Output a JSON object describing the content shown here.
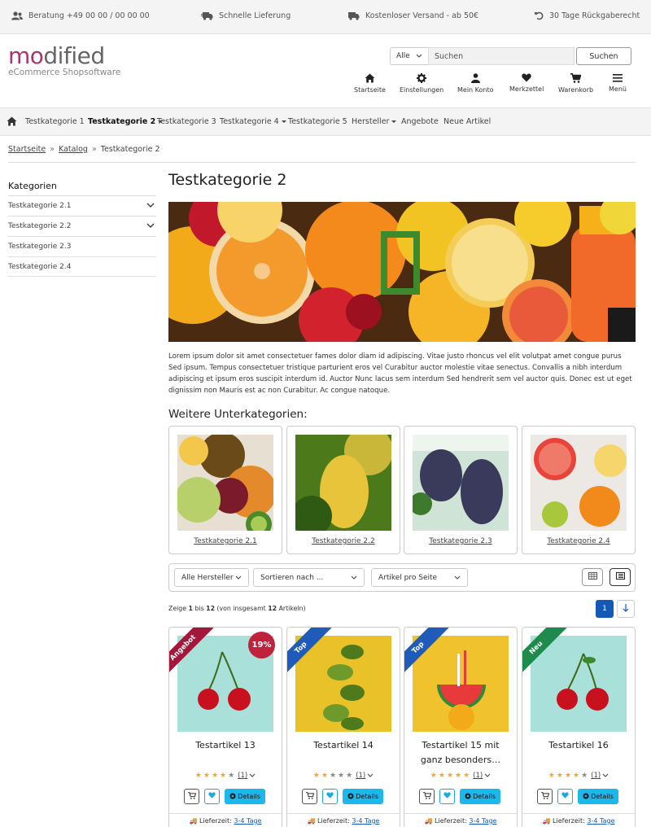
{
  "topbar": {
    "consult": "Beratung +49 00 00 / 00 00 00",
    "fast_delivery": "Schnelle Lieferung",
    "free_shipping": "Kostenloser Versand - ab 50€",
    "returns": "30 Tage Rückgaberecht"
  },
  "logo": {
    "main_accent": "mo",
    "main_rest": "dified",
    "sub": "eCommerce Shopsoftware"
  },
  "search": {
    "scope": "Alle",
    "placeholder": "Suchen",
    "button": "Suchen"
  },
  "header_icons": {
    "home": "Startseite",
    "settings": "Einstellungen",
    "account": "Mein Konto",
    "wishlist": "Merkzettel",
    "cart": "Warenkorb",
    "menu": "Menü"
  },
  "nav": {
    "items": [
      "Testkategorie 1",
      "Testkategorie 2",
      "Testkategorie 3",
      "Testkategorie 4",
      "Testkategorie 5",
      "Hersteller",
      "Angebote",
      "Neue Artikel"
    ]
  },
  "breadcrumb": {
    "home": "Startseite",
    "catalog": "Katalog",
    "current": "Testkategorie 2",
    "sep": "»"
  },
  "sidebar": {
    "title": "Kategorien",
    "items": [
      "Testkategorie 2.1",
      "Testkategorie 2.2",
      "Testkategorie 2.3",
      "Testkategorie 2.4"
    ]
  },
  "main": {
    "title": "Testkategorie 2",
    "description": "Lorem ipsum dolor sit amet consectetuer fames dolor diam id adipiscing. Vitae justo rhoncus vel elit volutpat amet congue purus Sed ipsum. Tempus consectetuer tristique parturient eros vel Curabitur auctor molestie vitae senectus. Convallis a nibh interdum adipiscing et ipsum eros suscipit interdum id. Auctor Nunc lacus sem interdum Sed hendrerit sem vel auctor quis. Donec est ut eget dignissim non Mauris est ac non Curabitur. Ac congue natoque.",
    "subcats_heading": "Weitere Unterkategorien:",
    "subcats": [
      "Testkategorie 2.1",
      "Testkategorie 2.2",
      "Testkategorie 2.3",
      "Testkategorie 2.4"
    ]
  },
  "filters": {
    "manufacturer": "Alle Hersteller",
    "sort": "Sortieren nach ...",
    "per_page": "Artikel pro Seite"
  },
  "paging": {
    "show": "Zeige",
    "from": "1",
    "to_word": "bis",
    "to": "12",
    "of_prefix": "(von insgesamt",
    "total": "12",
    "of_suffix": "Artikeln)",
    "current_page": "1"
  },
  "products": [
    {
      "name": "Testartikel 13",
      "ribbon": "Angebot",
      "ribbon_color": "#a3173a",
      "badge": "19%",
      "rating": 4,
      "rating_count": "(1)",
      "details": "Details",
      "delivery_label": "Lieferzeit:",
      "delivery_value": "3-4 Tage"
    },
    {
      "name": "Testartikel 14",
      "ribbon": "Top",
      "ribbon_color": "#1f5bb8",
      "badge": "",
      "rating": 2,
      "rating_count": "(1)",
      "details": "Details",
      "delivery_label": "Lieferzeit:",
      "delivery_value": "3-4 Tage"
    },
    {
      "name": "Testartikel 15 mit ganz besonders…",
      "ribbon": "Top",
      "ribbon_color": "#1f5bb8",
      "badge": "",
      "rating": 5,
      "rating_count": "(1)",
      "details": "Details",
      "delivery_label": "Lieferzeit:",
      "delivery_value": "3-4 Tage"
    },
    {
      "name": "Testartikel 16",
      "ribbon": "Neu",
      "ribbon_color": "#1e8a4c",
      "badge": "",
      "rating": 4,
      "rating_count": "(1)",
      "details": "Details",
      "delivery_label": "Lieferzeit:",
      "delivery_value": "3-4 Tage"
    }
  ],
  "colors": {
    "accent": "#a8356b",
    "link_blue": "#1559b7",
    "details_button": "#1cb8ec",
    "star": "#f5a623"
  }
}
